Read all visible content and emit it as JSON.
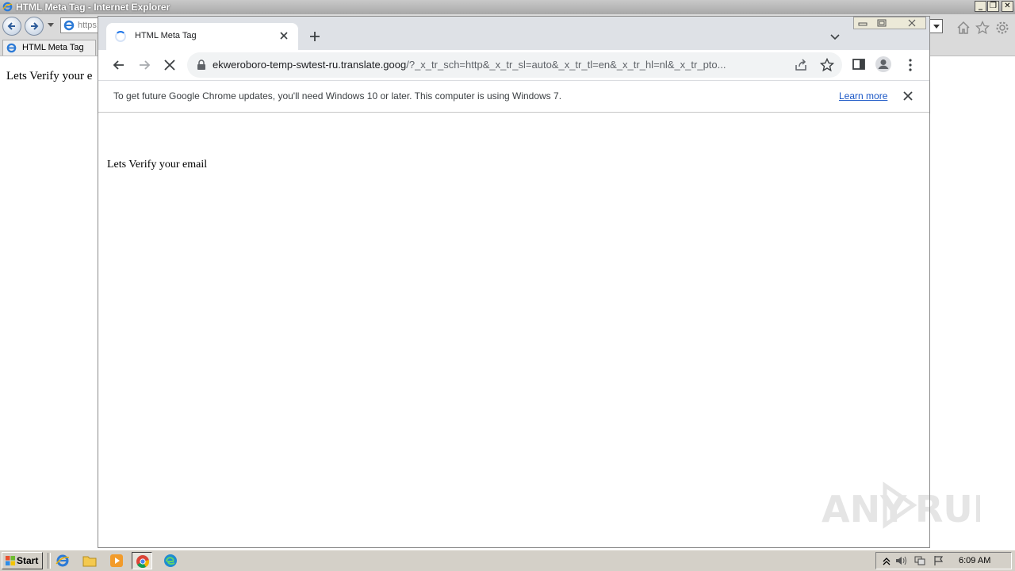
{
  "ie": {
    "title": "HTML Meta Tag - Internet Explorer",
    "address_text": "https:",
    "tab_title": "HTML Meta Tag",
    "content_text": "Lets Verify your e"
  },
  "chrome": {
    "tab_title": "HTML Meta Tag",
    "url_host": "ekweroboro-temp-swtest-ru.translate.goog",
    "url_rest": "/?_x_tr_sch=http&_x_tr_sl=auto&_x_tr_tl=en&_x_tr_hl=nl&_x_tr_pto...",
    "infobar_message": "To get future Google Chrome updates, you'll need Windows 10 or later. This computer is using Windows 7.",
    "infobar_link": "Learn more",
    "page_text": "Lets Verify your email",
    "loading": true
  },
  "watermark": {
    "text_left": "ANY",
    "text_right": "RUN"
  },
  "taskbar": {
    "start_label": "Start",
    "apps": [
      "internet-explorer-icon",
      "folder-icon",
      "media-player-icon",
      "chrome-icon",
      "edge-icon"
    ],
    "active_app": "chrome-icon",
    "clock": "6:09 AM"
  },
  "colors": {
    "chrome_tabbar": "#dee1e6",
    "omnibox": "#f1f3f4",
    "link": "#1a57c6",
    "taskbar": "#d4d0c8"
  }
}
